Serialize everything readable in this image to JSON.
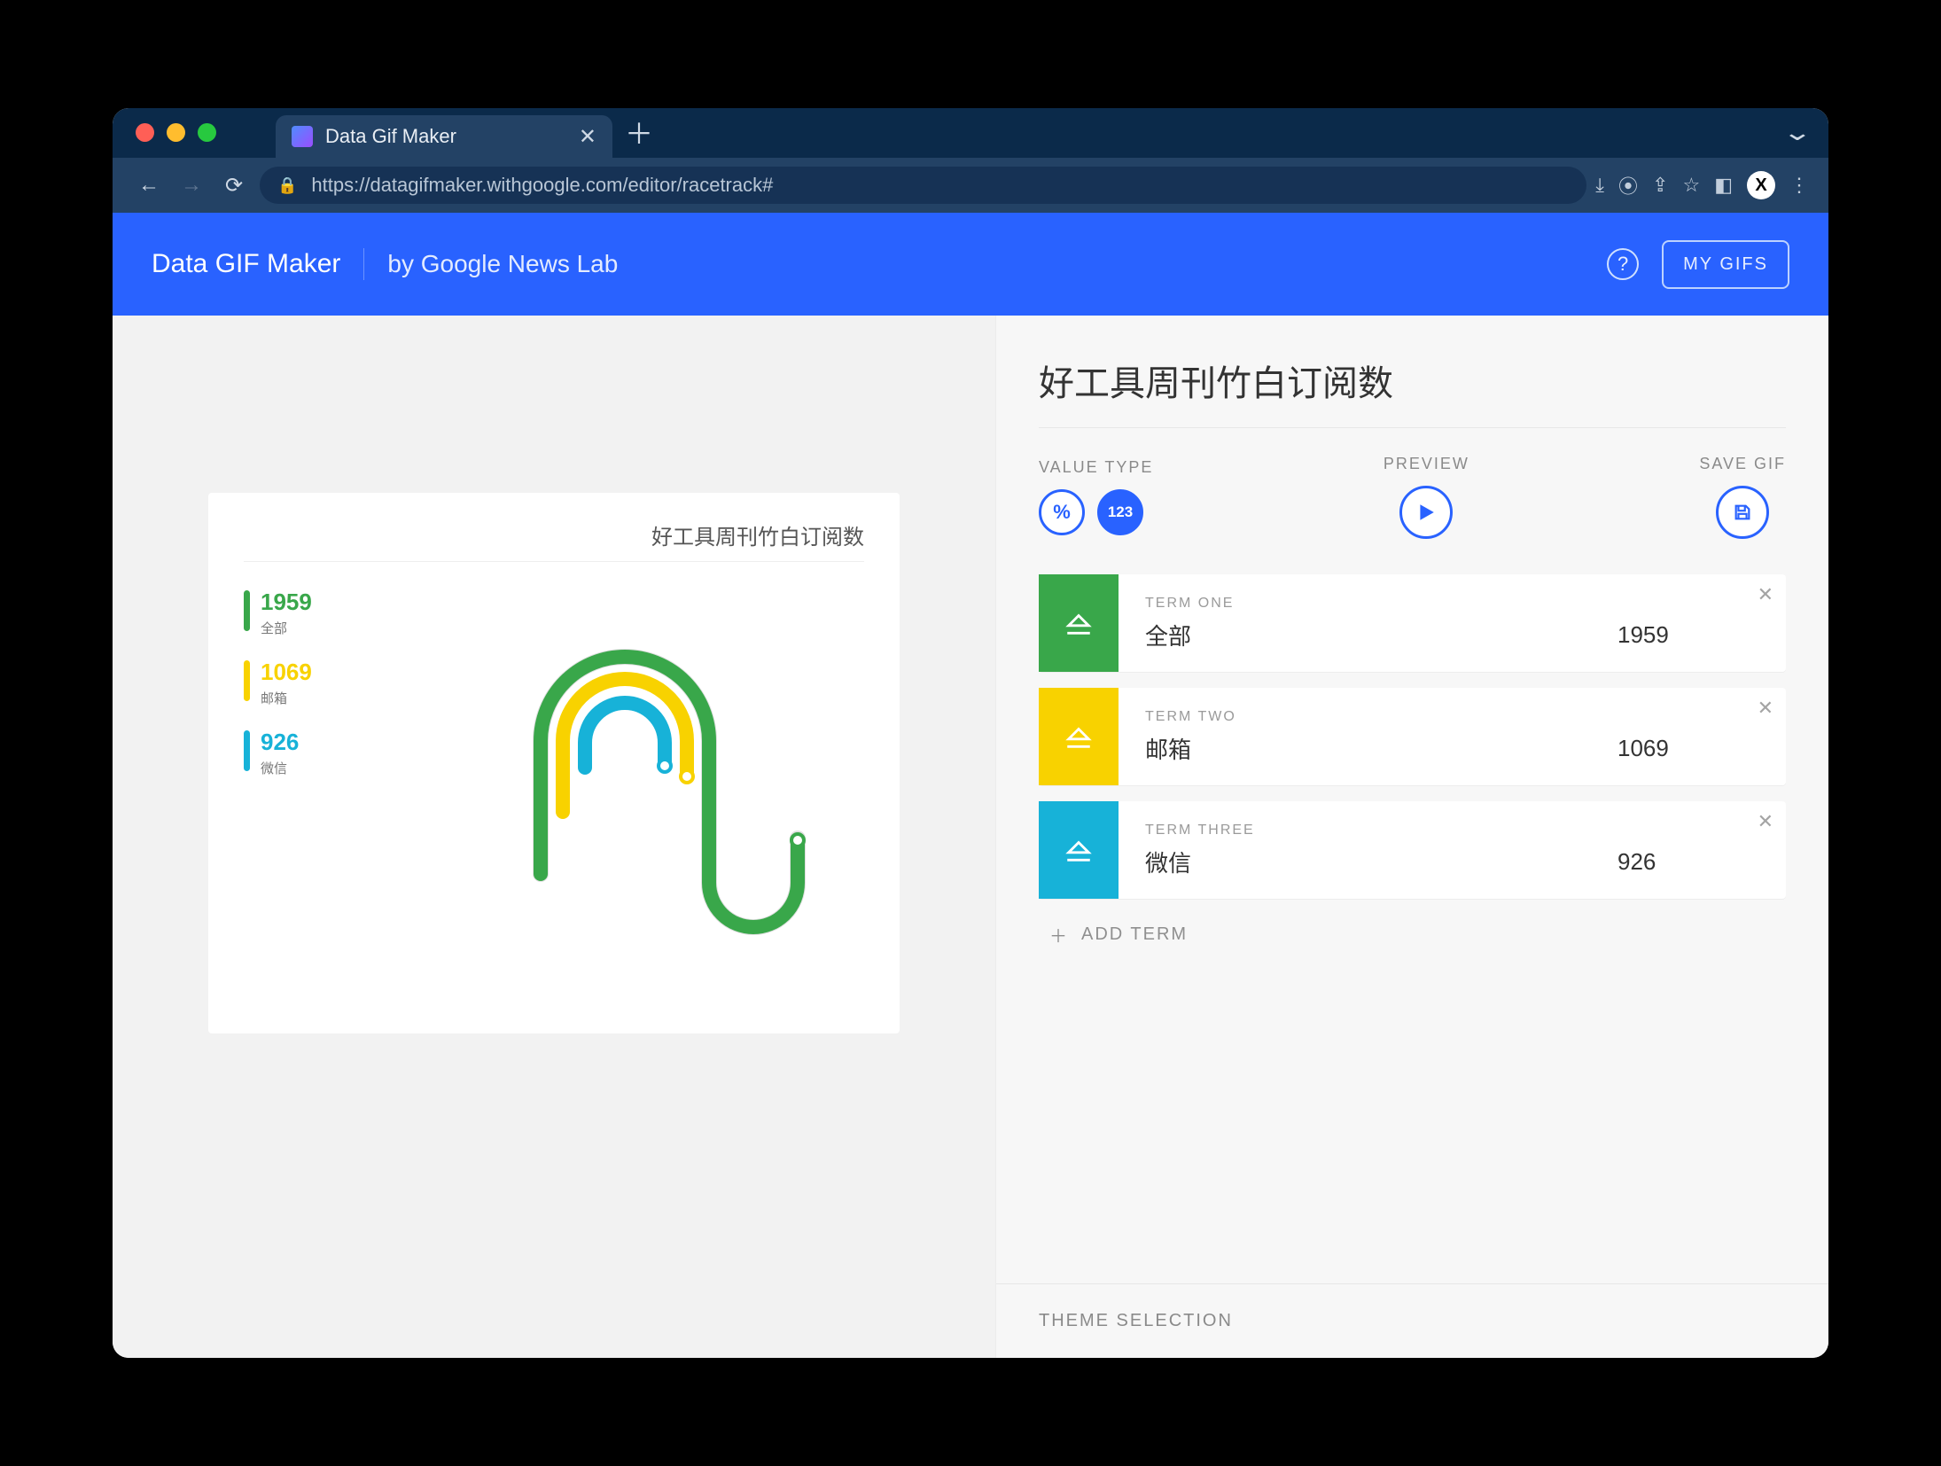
{
  "browser": {
    "tab_title": "Data Gif Maker",
    "url": "https://datagifmaker.withgoogle.com/editor/racetrack#"
  },
  "appbar": {
    "title": "Data GIF Maker",
    "subtitle": "by Google News Lab",
    "mygifs": "MY GIFS"
  },
  "editor": {
    "title": "好工具周刊竹白订阅数",
    "value_type_label": "VALUE TYPE",
    "value_type_percent": "%",
    "value_type_number": "123",
    "preview_label": "PREVIEW",
    "save_label": "SAVE GIF",
    "terms": [
      {
        "header": "TERM ONE",
        "name": "全部",
        "value": "1959",
        "color": "#39a74a"
      },
      {
        "header": "TERM TWO",
        "name": "邮箱",
        "value": "1069",
        "color": "#f8d200"
      },
      {
        "header": "TERM THREE",
        "name": "微信",
        "value": "926",
        "color": "#17b2d8"
      }
    ],
    "add_term": "ADD TERM",
    "theme_selection": "THEME SELECTION"
  },
  "preview": {
    "title": "好工具周刊竹白订阅数"
  },
  "chart_data": {
    "type": "bar",
    "title": "好工具周刊竹白订阅数",
    "categories": [
      "全部",
      "邮箱",
      "微信"
    ],
    "values": [
      1959,
      1069,
      926
    ],
    "series": [
      {
        "name": "全部",
        "value": 1959,
        "color": "#39a74a"
      },
      {
        "name": "邮箱",
        "value": 1069,
        "color": "#f8d200"
      },
      {
        "name": "微信",
        "value": 926,
        "color": "#17b2d8"
      }
    ],
    "xlabel": "",
    "ylabel": "",
    "ylim": [
      0,
      1959
    ]
  }
}
